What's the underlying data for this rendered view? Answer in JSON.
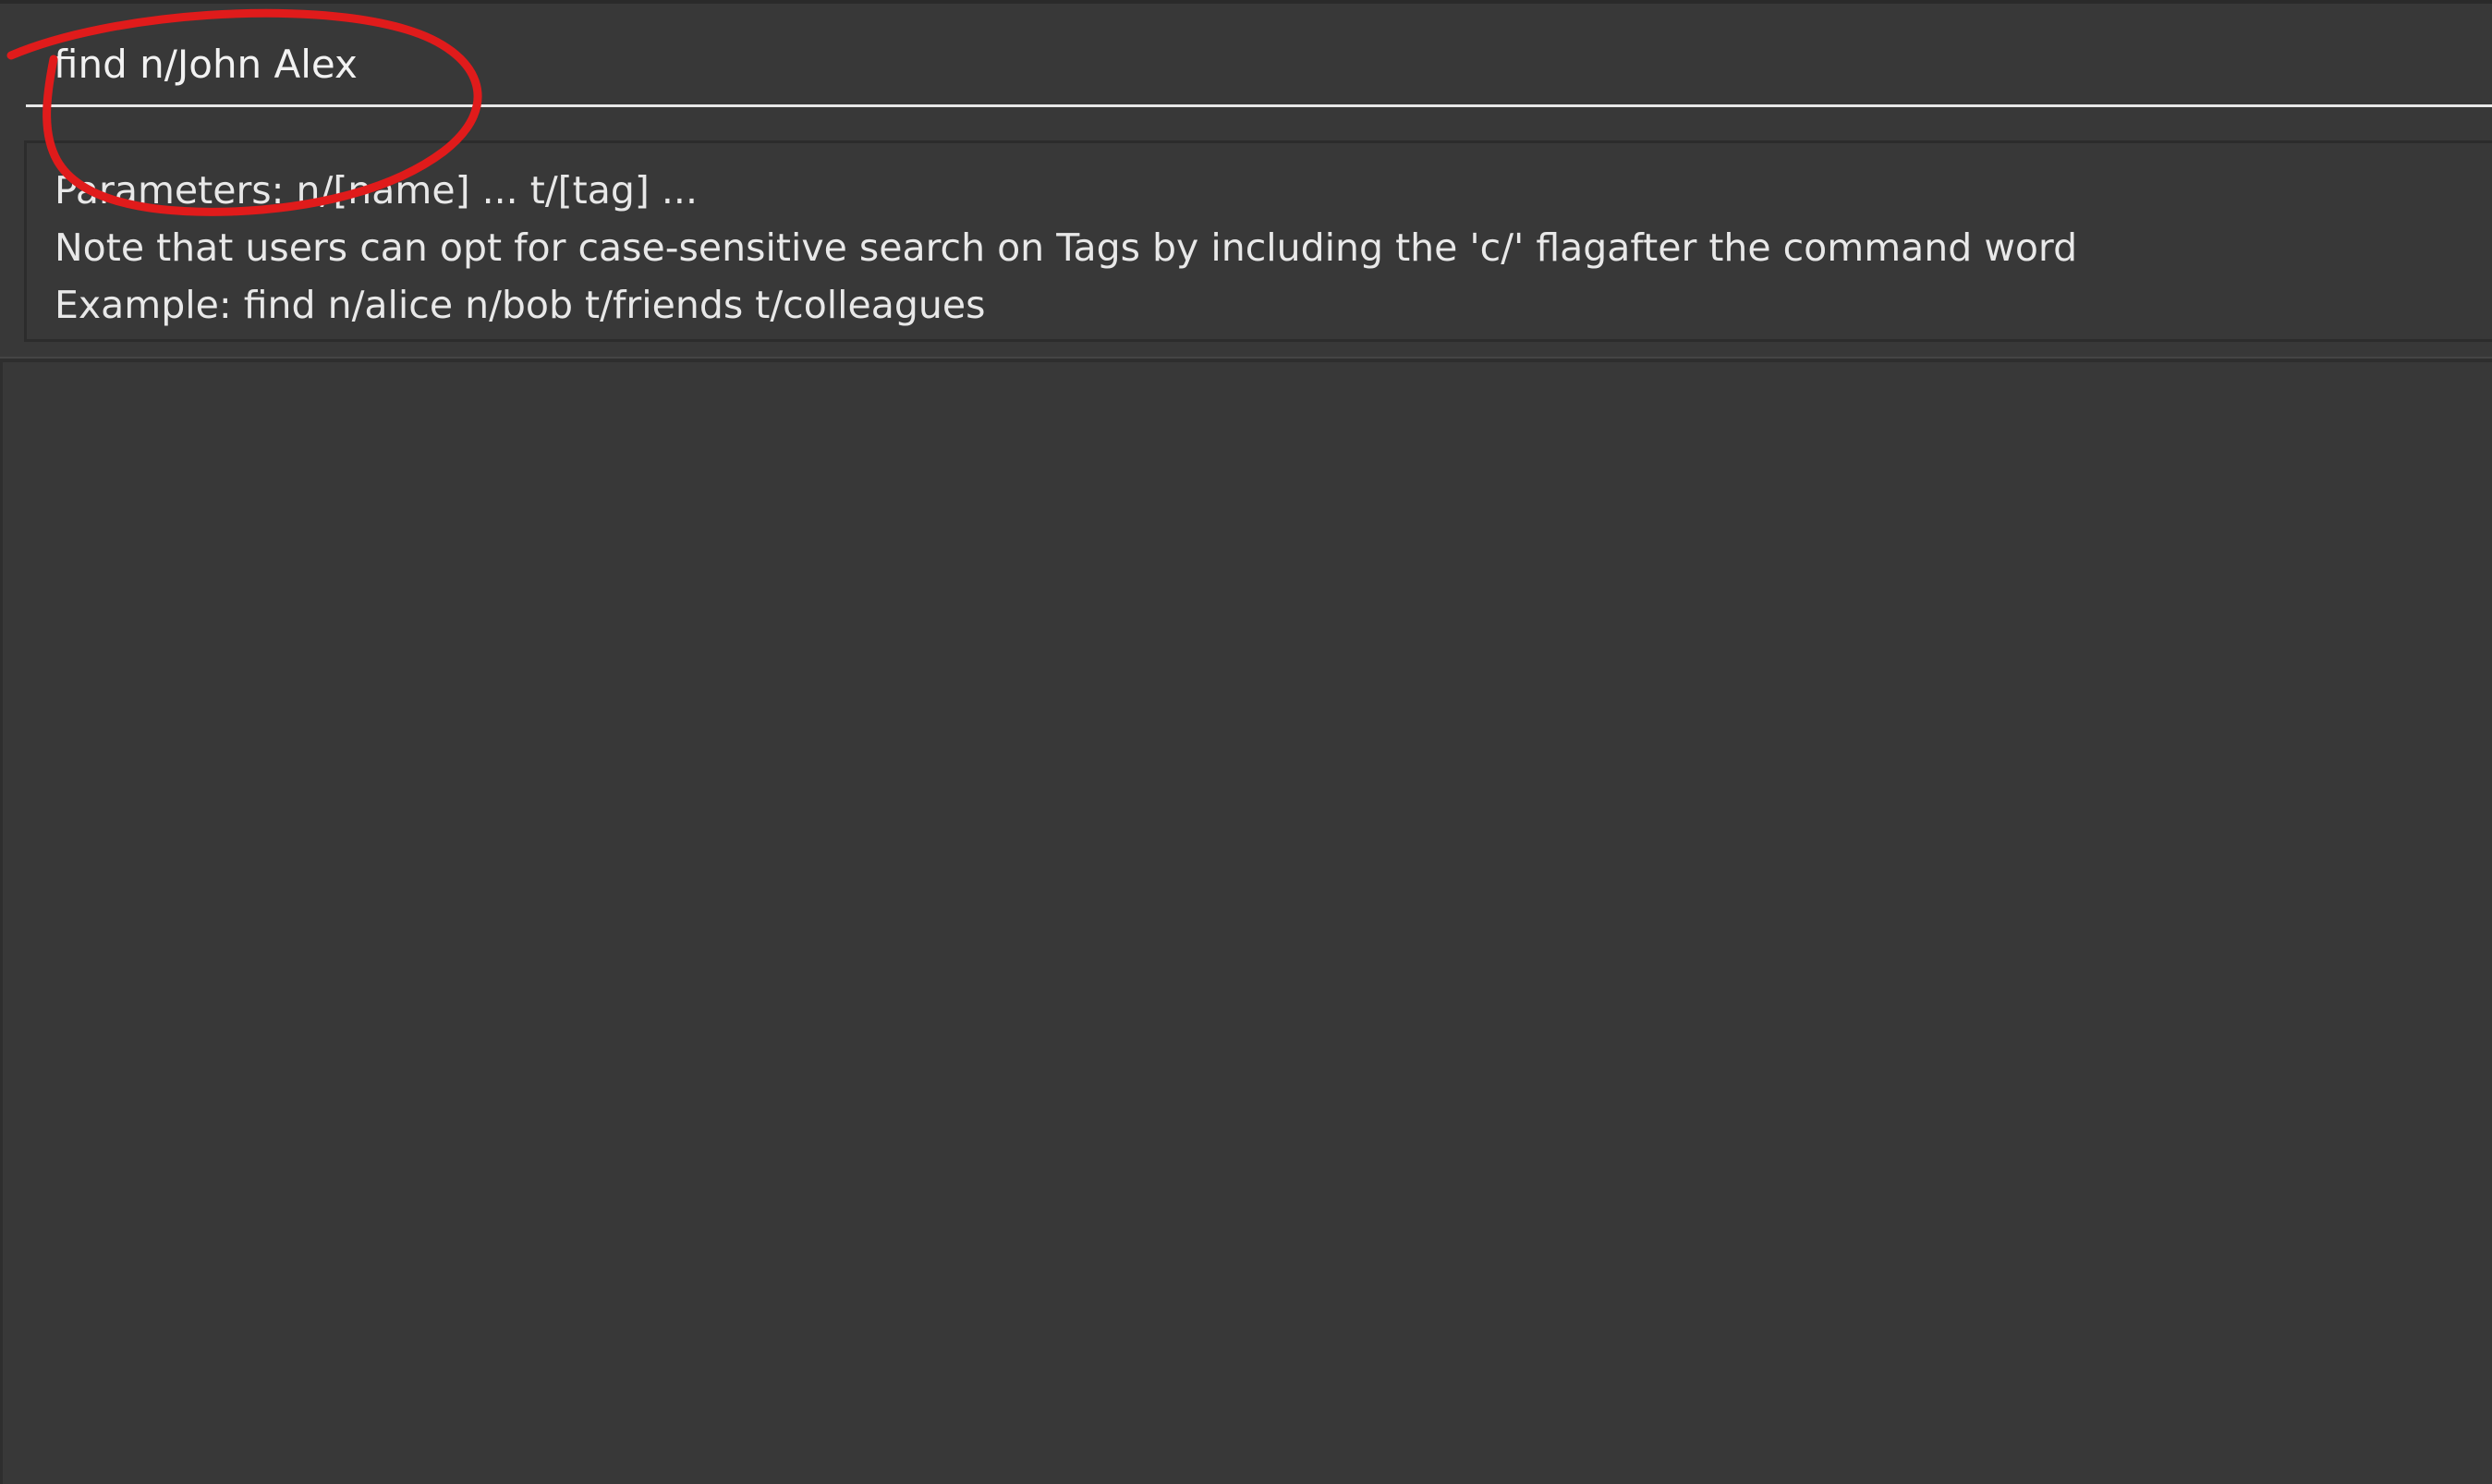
{
  "command_box": {
    "value": "find n/John Alex"
  },
  "result_display": {
    "lines": [
      "Parameters: n/[name] ... t/[tag] ...",
      "Note that users can opt for case-sensitive search on Tags by including the 'c/' flagafter the command word",
      "Example: find n/alice n/bob t/friends t/colleagues"
    ]
  },
  "annotation": {
    "color": "#e01b1b",
    "shape": "circle"
  },
  "colors": {
    "background": "#383838",
    "text": "#e8e8e8",
    "underline": "#e8e8e8"
  }
}
